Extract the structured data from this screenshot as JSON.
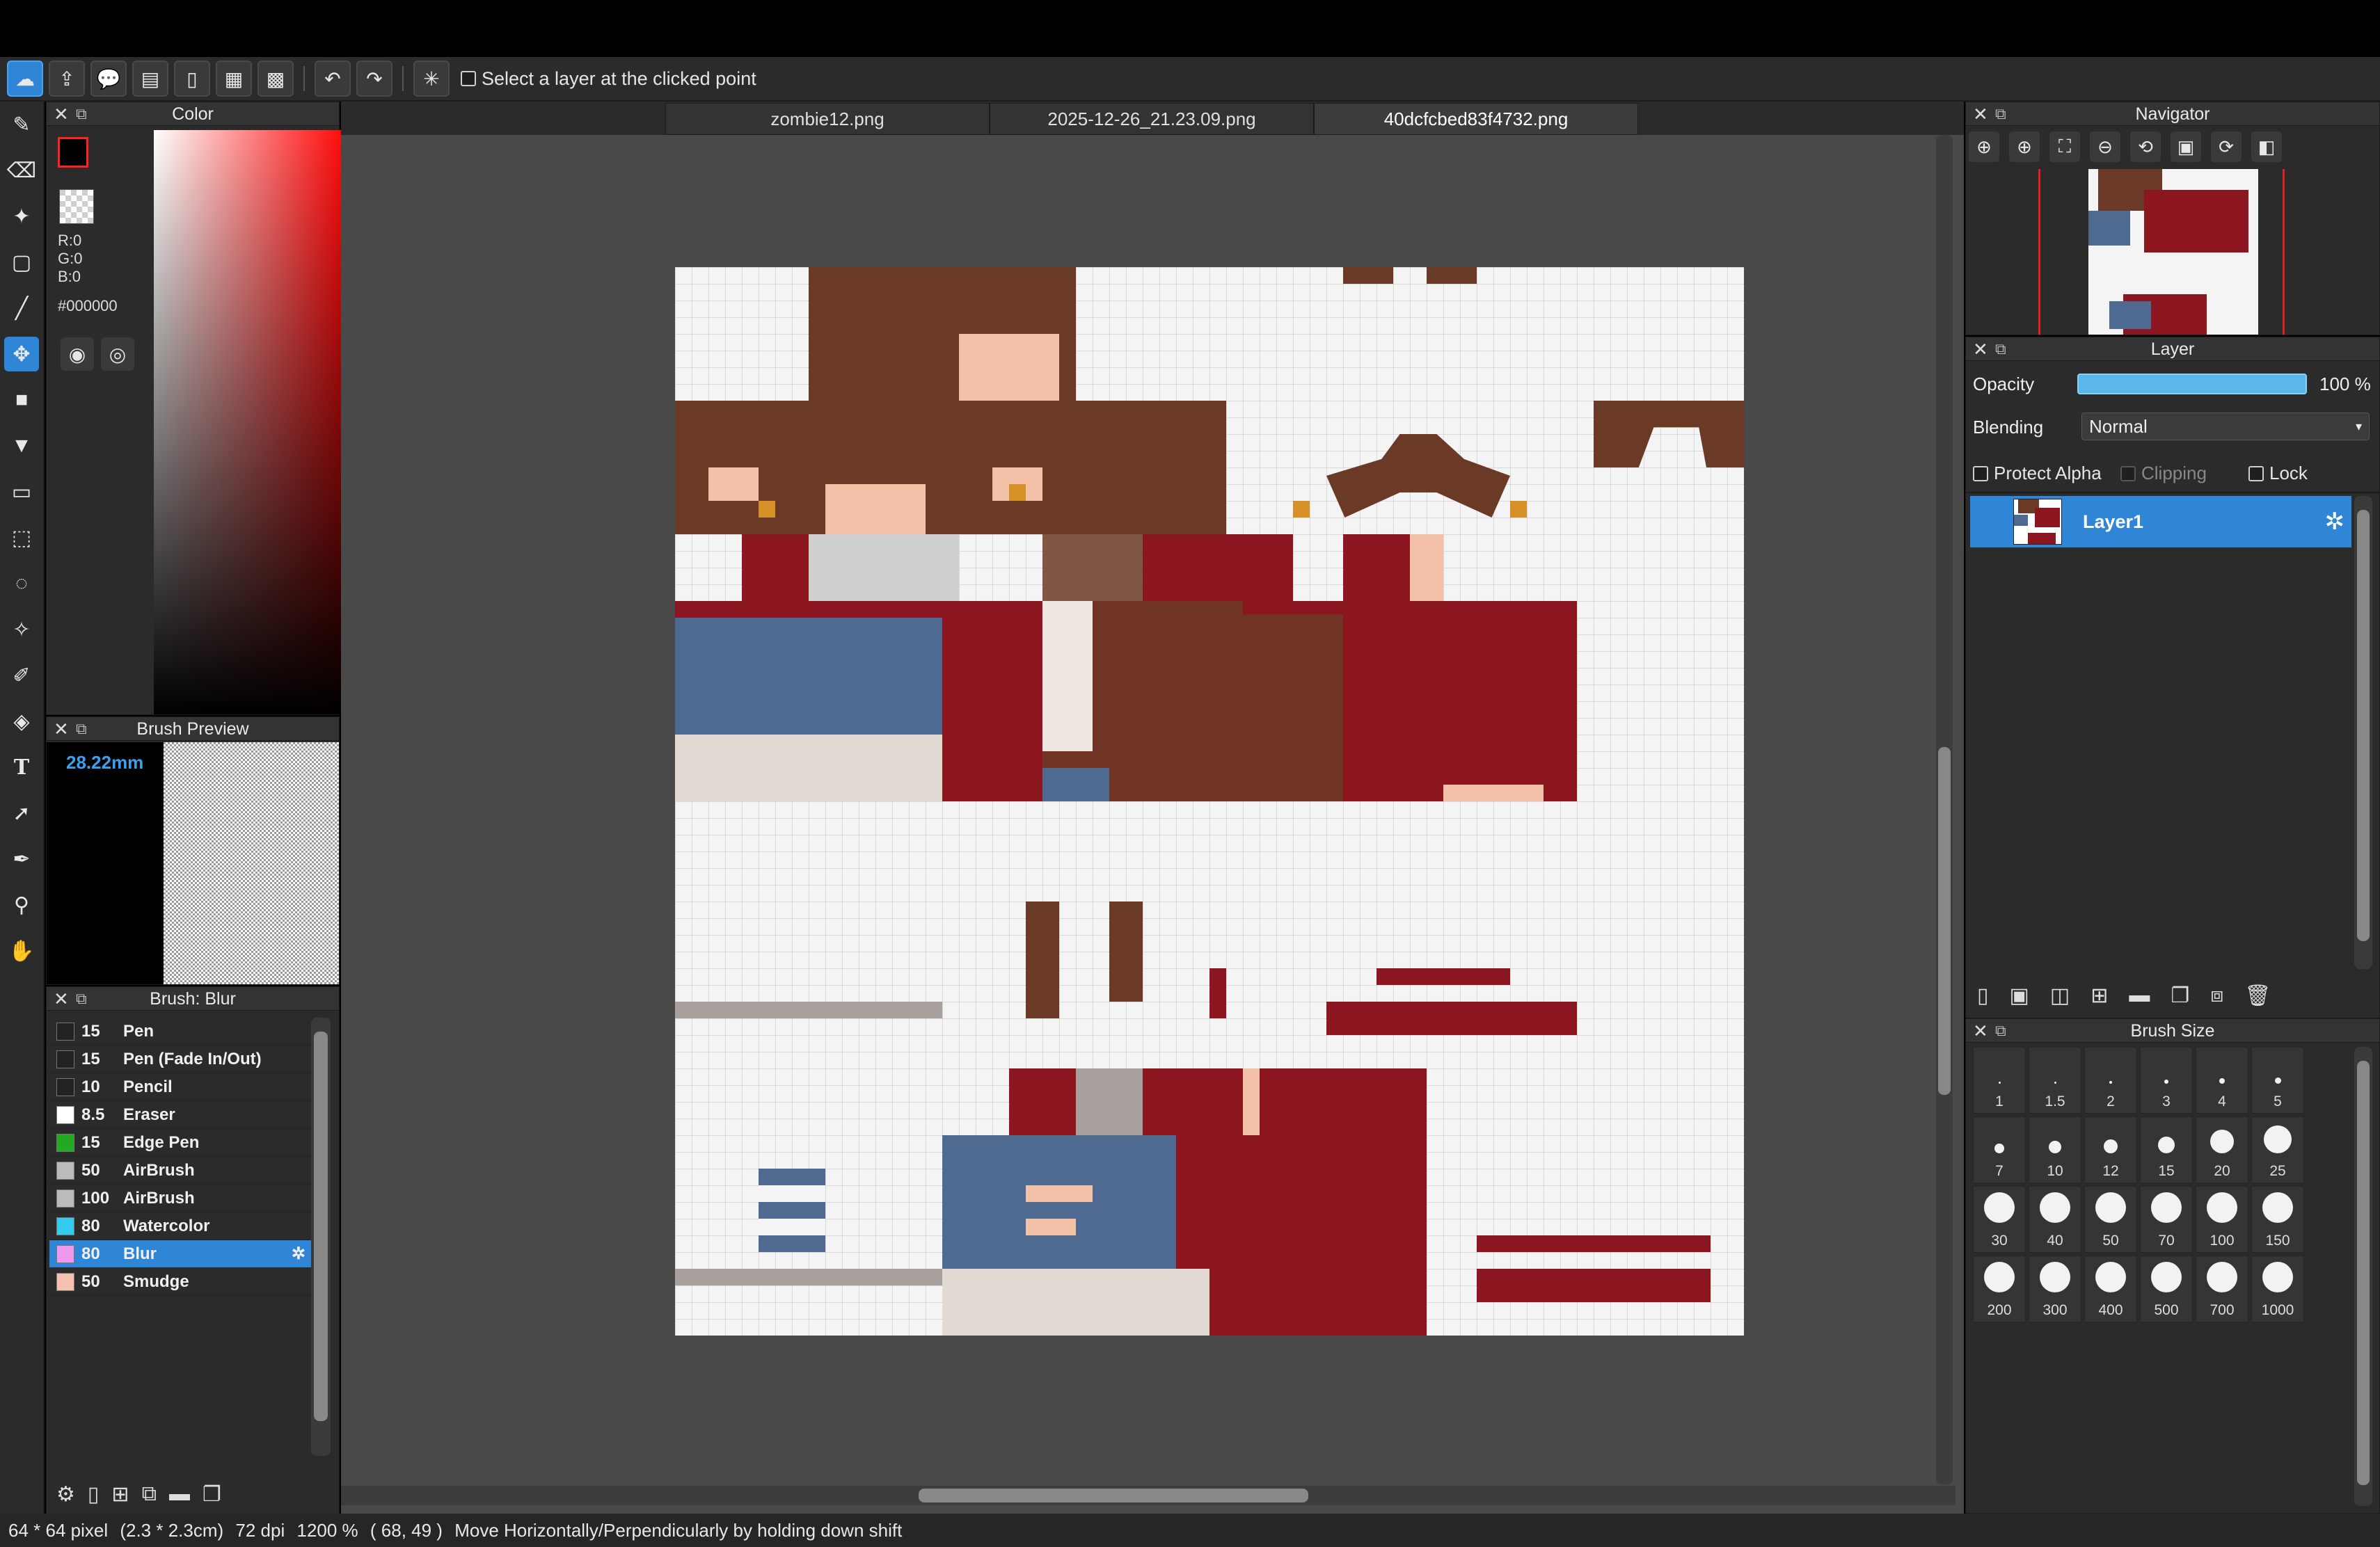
{
  "toolbar": {
    "select_layer_label": "Select a layer at the clicked point",
    "select_layer_checked": false
  },
  "tabs": [
    {
      "label": "zombie12.png",
      "active": false
    },
    {
      "label": "2025-12-26_21.23.09.png",
      "active": false
    },
    {
      "label": "40dcfcbed83f4732.png",
      "active": true
    }
  ],
  "color_panel": {
    "title": "Color",
    "r_label": "R:0",
    "g_label": "G:0",
    "b_label": "B:0",
    "hex": "#000000",
    "foreground_color": "#000000",
    "hue_color": "#ff0000"
  },
  "brush_preview": {
    "title": "Brush Preview",
    "size_label": "28.22mm"
  },
  "brush_list": {
    "title": "Brush: Blur",
    "items": [
      {
        "size": "15",
        "name": "Pen",
        "color": "#222222",
        "selected": false
      },
      {
        "size": "15",
        "name": "Pen (Fade In/Out)",
        "color": "#222222",
        "selected": false
      },
      {
        "size": "10",
        "name": "Pencil",
        "color": "#222222",
        "selected": false
      },
      {
        "size": "8.5",
        "name": "Eraser",
        "color": "#ffffff",
        "selected": false
      },
      {
        "size": "15",
        "name": "Edge Pen",
        "color": "#22aa22",
        "selected": false
      },
      {
        "size": "50",
        "name": "AirBrush",
        "color": "#bbbbbb",
        "selected": false
      },
      {
        "size": "100",
        "name": "AirBrush",
        "color": "#bbbbbb",
        "selected": false
      },
      {
        "size": "80",
        "name": "Watercolor",
        "color": "#33ccee",
        "selected": false
      },
      {
        "size": "80",
        "name": "Blur",
        "color": "#ee99ee",
        "selected": true
      },
      {
        "size": "50",
        "name": "Smudge",
        "color": "#f4c0b0",
        "selected": false
      }
    ]
  },
  "navigator": {
    "title": "Navigator"
  },
  "layer_panel": {
    "title": "Layer",
    "opacity_label": "Opacity",
    "opacity_value": "100 %",
    "opacity_fraction": 1.0,
    "blending_label": "Blending",
    "blending_value": "Normal",
    "protect_alpha_label": "Protect Alpha",
    "clipping_label": "Clipping",
    "lock_label": "Lock",
    "layers": [
      {
        "name": "Layer1",
        "selected": true
      }
    ]
  },
  "brush_size": {
    "title": "Brush Size",
    "sizes": [
      "1",
      "1.5",
      "2",
      "3",
      "4",
      "5",
      "7",
      "10",
      "12",
      "15",
      "20",
      "25",
      "30",
      "40",
      "50",
      "70",
      "100",
      "150",
      "200",
      "300",
      "400",
      "500",
      "700",
      "1000"
    ]
  },
  "status": {
    "dimensions": "64 * 64 pixel",
    "physical": "(2.3 * 2.3cm)",
    "dpi": "72 dpi",
    "zoom": "1200 %",
    "cursor": "( 68, 49 )",
    "hint": "Move Horizontally/Perpendicularly by holding down shift"
  },
  "colors": {
    "accent": "#2f86d6",
    "skin_brown": "#6b3a26",
    "skin_red": "#8b1620",
    "skin_blue": "#4f6a91",
    "skin_peach": "#f3c1a8"
  }
}
